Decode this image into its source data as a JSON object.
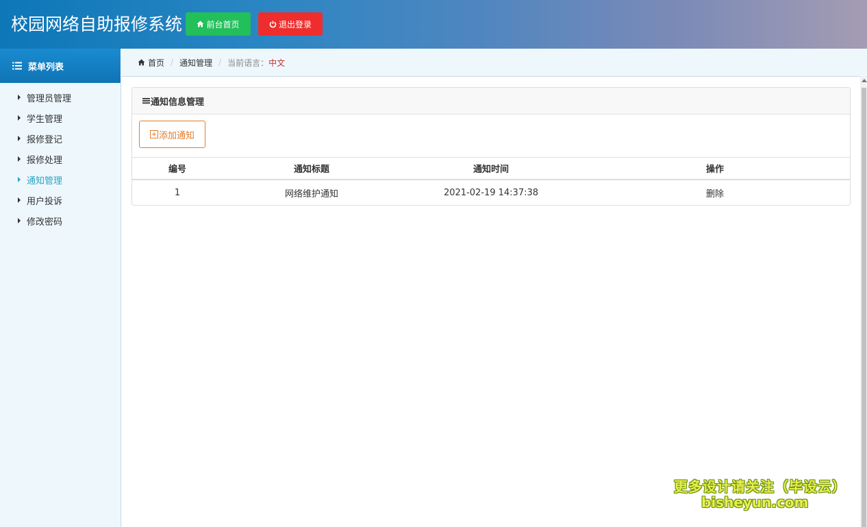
{
  "header": {
    "title": "校园网络自助报修系统",
    "home_button": "前台首页",
    "logout_button": "退出登录",
    "colors": {
      "home_button": "#22bf5b",
      "logout_button": "#ef2d2d"
    }
  },
  "sidebar": {
    "heading": "菜单列表",
    "items": [
      {
        "label": "管理员管理",
        "active": false
      },
      {
        "label": "学生管理",
        "active": false
      },
      {
        "label": "报修登记",
        "active": false
      },
      {
        "label": "报修处理",
        "active": false
      },
      {
        "label": "通知管理",
        "active": true
      },
      {
        "label": "用户投诉",
        "active": false
      },
      {
        "label": "修改密码",
        "active": false
      }
    ]
  },
  "breadcrumb": {
    "home": "首页",
    "current": "通知管理",
    "language_label": "当前语言：",
    "language_value": "中文"
  },
  "panel": {
    "title": "通知信息管理",
    "add_button": "添加通知",
    "table": {
      "headers": [
        "编号",
        "通知标题",
        "通知时间",
        "操作"
      ],
      "rows": [
        {
          "id": "1",
          "title": "网络维护通知",
          "time": "2021-02-19 14:37:38",
          "action": "删除"
        }
      ]
    }
  },
  "watermark": {
    "line1": "更多设计请关注（毕设云）",
    "line2": "bisheyun.com"
  }
}
